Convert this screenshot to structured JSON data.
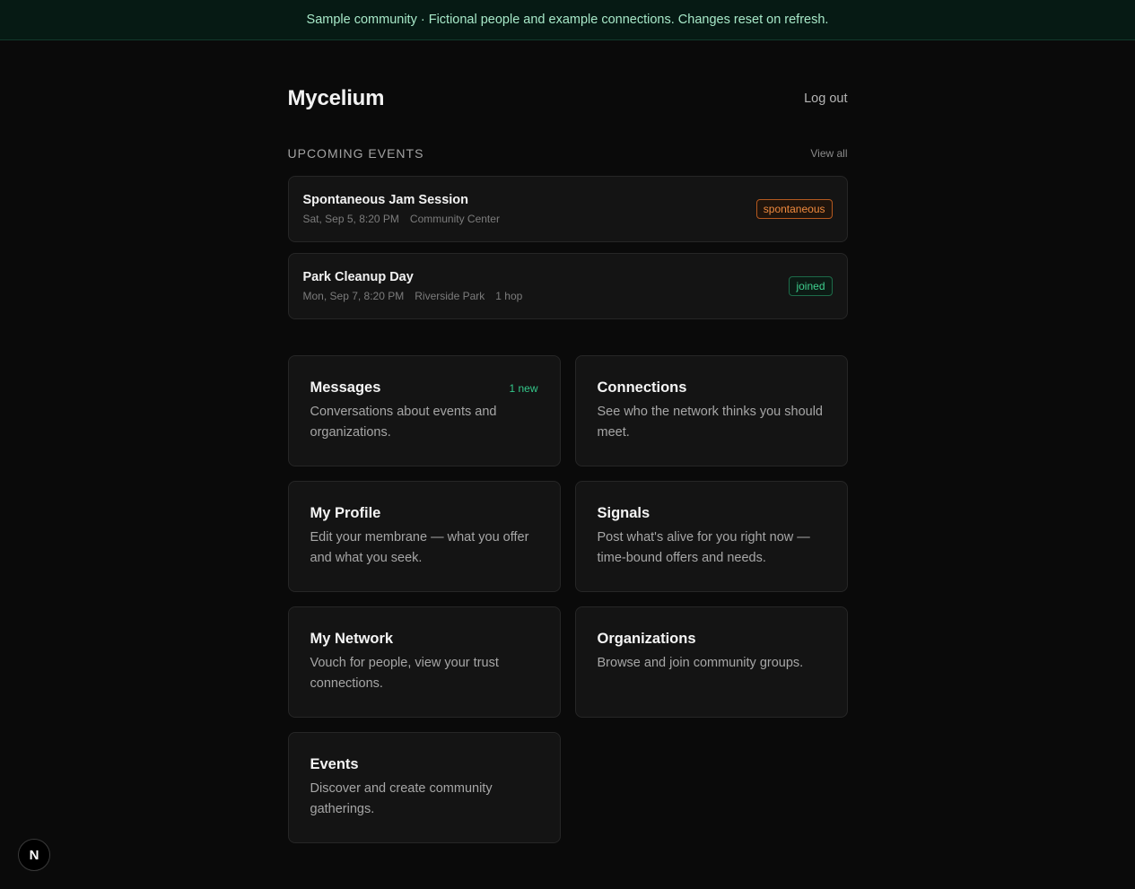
{
  "banner": {
    "text": "Sample community · Fictional people and example connections. Changes reset on refresh."
  },
  "header": {
    "brand": "Mycelium",
    "logout_label": "Log out"
  },
  "events_section": {
    "title": "UPCOMING EVENTS",
    "view_all_label": "View all",
    "events": [
      {
        "name": "Spontaneous Jam Session",
        "date": "Sat, Sep 5, 8:20 PM",
        "location": "Community Center",
        "distance": "",
        "badge": "spontaneous"
      },
      {
        "name": "Park Cleanup Day",
        "date": "Mon, Sep 7, 8:20 PM",
        "location": "Riverside Park",
        "distance": "1 hop",
        "badge": "joined"
      }
    ]
  },
  "cards": [
    {
      "title": "Messages",
      "badge": "1 new",
      "desc": "Conversations about events and organizations."
    },
    {
      "title": "Connections",
      "badge": "",
      "desc": "See who the network thinks you should meet."
    },
    {
      "title": "My Profile",
      "badge": "",
      "desc": "Edit your membrane — what you offer and what you seek."
    },
    {
      "title": "Signals",
      "badge": "",
      "desc": "Post what's alive for you right now — time-bound offers and needs."
    },
    {
      "title": "My Network",
      "badge": "",
      "desc": "Vouch for people, view your trust connections."
    },
    {
      "title": "Organizations",
      "badge": "",
      "desc": "Browse and join community groups."
    },
    {
      "title": "Events",
      "badge": "",
      "desc": "Discover and create community gatherings."
    }
  ],
  "dev_badge": {
    "label": "N"
  },
  "colors": {
    "accent_green": "#34c78a",
    "accent_orange": "#f08a3e",
    "background": "#0a0a0a"
  }
}
